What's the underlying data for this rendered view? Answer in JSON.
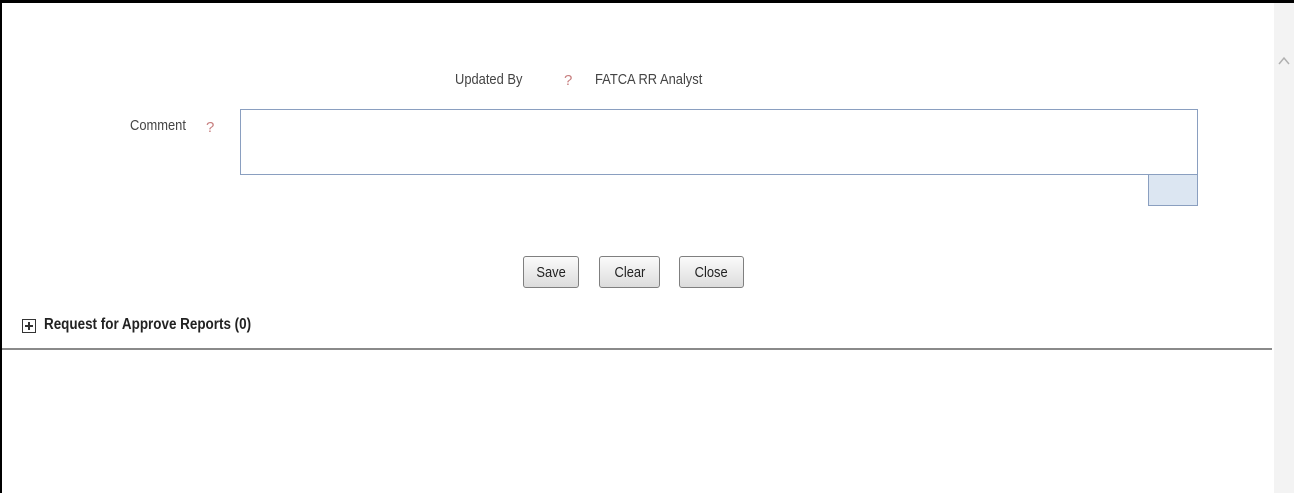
{
  "form": {
    "updated_by_label": "Updated By",
    "updated_by_help": "?",
    "updated_by_value": "FATCA RR Analyst",
    "comment_label": "Comment",
    "comment_help": "?",
    "comment_value": ""
  },
  "buttons": {
    "save_label": "Save",
    "clear_label": "Clear",
    "close_label": "Close"
  },
  "section": {
    "title": "Request for Approve Reports (0)",
    "expand_icon": "plus-box-icon"
  },
  "scrollbar": {
    "up_icon": "chevron-up-icon"
  },
  "colors": {
    "help_icon": "#c77e7e",
    "textarea_border": "#8a9fc0",
    "resize_handle": "#dce6f2"
  }
}
